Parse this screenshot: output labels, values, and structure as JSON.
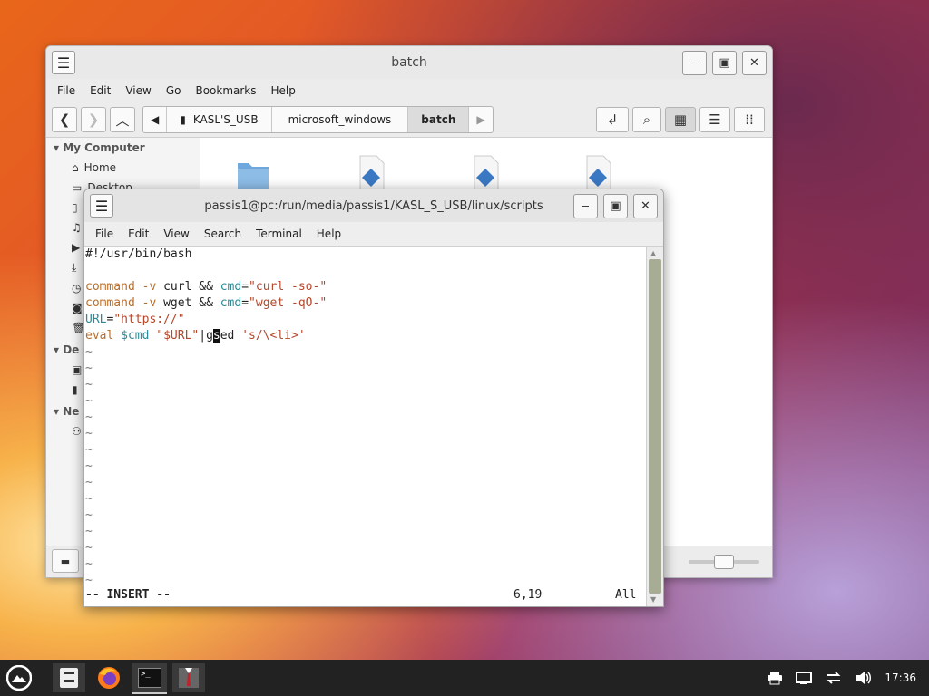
{
  "file_manager": {
    "title": "batch",
    "menu": [
      "File",
      "Edit",
      "View",
      "Go",
      "Bookmarks",
      "Help"
    ],
    "breadcrumbs": [
      "KASL'S_USB",
      "microsoft_windows",
      "batch"
    ],
    "sidebar": {
      "section_computer": "My Computer",
      "items": [
        "Home",
        "Desktop"
      ],
      "section_devices": "De",
      "section_network": "Ne"
    }
  },
  "terminal": {
    "title": "passis1@pc:/run/media/passis1/KASL_S_USB/linux/scripts",
    "menu": [
      "File",
      "Edit",
      "View",
      "Search",
      "Terminal",
      "Help"
    ],
    "lines": [
      "#!/usr/bin/bash",
      "",
      "command -v curl && cmd=\"curl -so-\"",
      "command -v wget && cmd=\"wget -qO-\"",
      "URL=\"https://\"",
      "eval $cmd \"$URL\"|gsed 's/\\<li>'"
    ],
    "tilde": "~",
    "mode": "-- INSERT --",
    "position": "6,19",
    "scroll": "All"
  },
  "taskbar": {
    "clock": "17:36",
    "terminal_icon": ">_"
  }
}
